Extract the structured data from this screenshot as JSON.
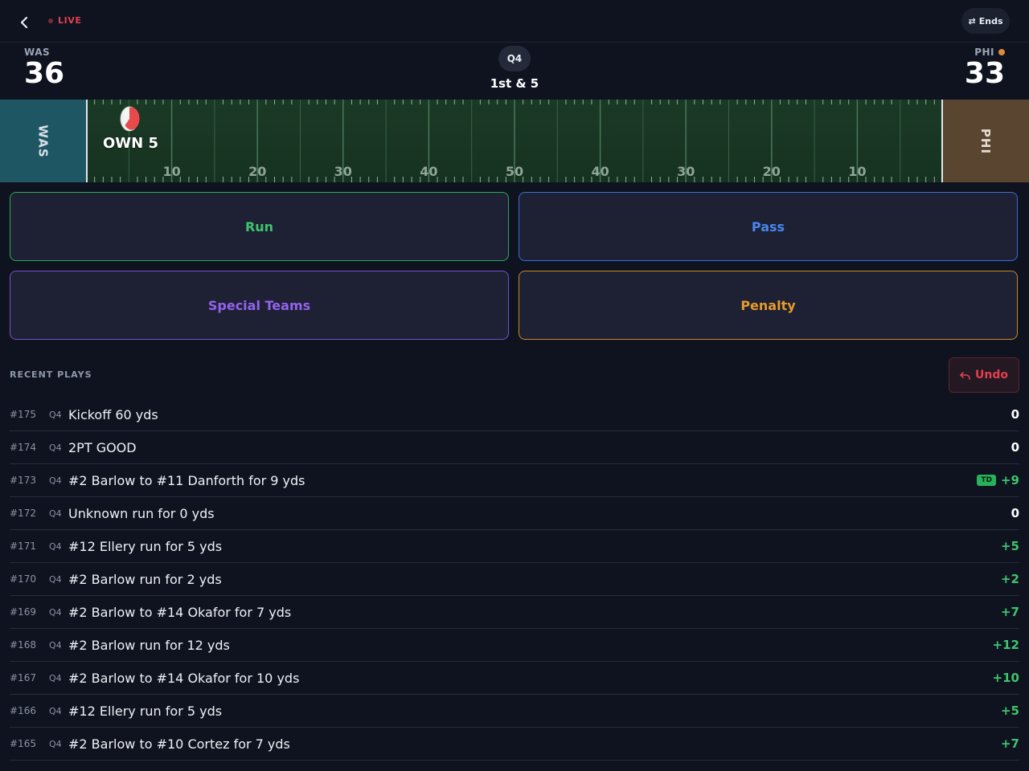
{
  "topbar": {
    "live_label": "LIVE",
    "ends_label": "Ends",
    "ends_icon": "⇄"
  },
  "scoreboard": {
    "away": {
      "abbr": "WAS",
      "score": "36"
    },
    "home": {
      "abbr": "PHI",
      "score": "33",
      "has_possession": true
    },
    "quarter": "Q4",
    "down_distance": "1st & 5"
  },
  "field": {
    "away_endzone": "WAS",
    "home_endzone": "PHI",
    "ball_spot_label": "OWN 5",
    "ball_yardline": 5,
    "yard_numbers": [
      "10",
      "20",
      "30",
      "40",
      "50",
      "40",
      "30",
      "20",
      "10"
    ],
    "colors": {
      "away_endzone": "#1f5663",
      "home_endzone": "#5a4530",
      "turf": "#1b3a26",
      "ball_marker": "#e84a4a"
    }
  },
  "play_buttons": {
    "run": "Run",
    "pass": "Pass",
    "special": "Special Teams",
    "penalty": "Penalty"
  },
  "recent": {
    "title": "RECENT PLAYS",
    "undo_label": "Undo",
    "plays": [
      {
        "num": "#175",
        "q": "Q4",
        "desc": "Kickoff 60 yds",
        "yds": "0",
        "td": ""
      },
      {
        "num": "#174",
        "q": "Q4",
        "desc": "2PT GOOD",
        "yds": "0",
        "td": ""
      },
      {
        "num": "#173",
        "q": "Q4",
        "desc": "#2 Barlow to #11 Danforth for 9 yds",
        "yds": "+9",
        "td": "TD"
      },
      {
        "num": "#172",
        "q": "Q4",
        "desc": "Unknown run for 0 yds",
        "yds": "0",
        "td": ""
      },
      {
        "num": "#171",
        "q": "Q4",
        "desc": "#12 Ellery run for 5 yds",
        "yds": "+5",
        "td": ""
      },
      {
        "num": "#170",
        "q": "Q4",
        "desc": "#2 Barlow run for 2 yds",
        "yds": "+2",
        "td": ""
      },
      {
        "num": "#169",
        "q": "Q4",
        "desc": "#2 Barlow to #14 Okafor for 7 yds",
        "yds": "+7",
        "td": ""
      },
      {
        "num": "#168",
        "q": "Q4",
        "desc": "#2 Barlow run for 12 yds",
        "yds": "+12",
        "td": ""
      },
      {
        "num": "#167",
        "q": "Q4",
        "desc": "#2 Barlow to #14 Okafor for 10 yds",
        "yds": "+10",
        "td": ""
      },
      {
        "num": "#166",
        "q": "Q4",
        "desc": "#12 Ellery run for 5 yds",
        "yds": "+5",
        "td": ""
      },
      {
        "num": "#165",
        "q": "Q4",
        "desc": "#2 Barlow to #10 Cortez for 7 yds",
        "yds": "+7",
        "td": ""
      }
    ]
  }
}
